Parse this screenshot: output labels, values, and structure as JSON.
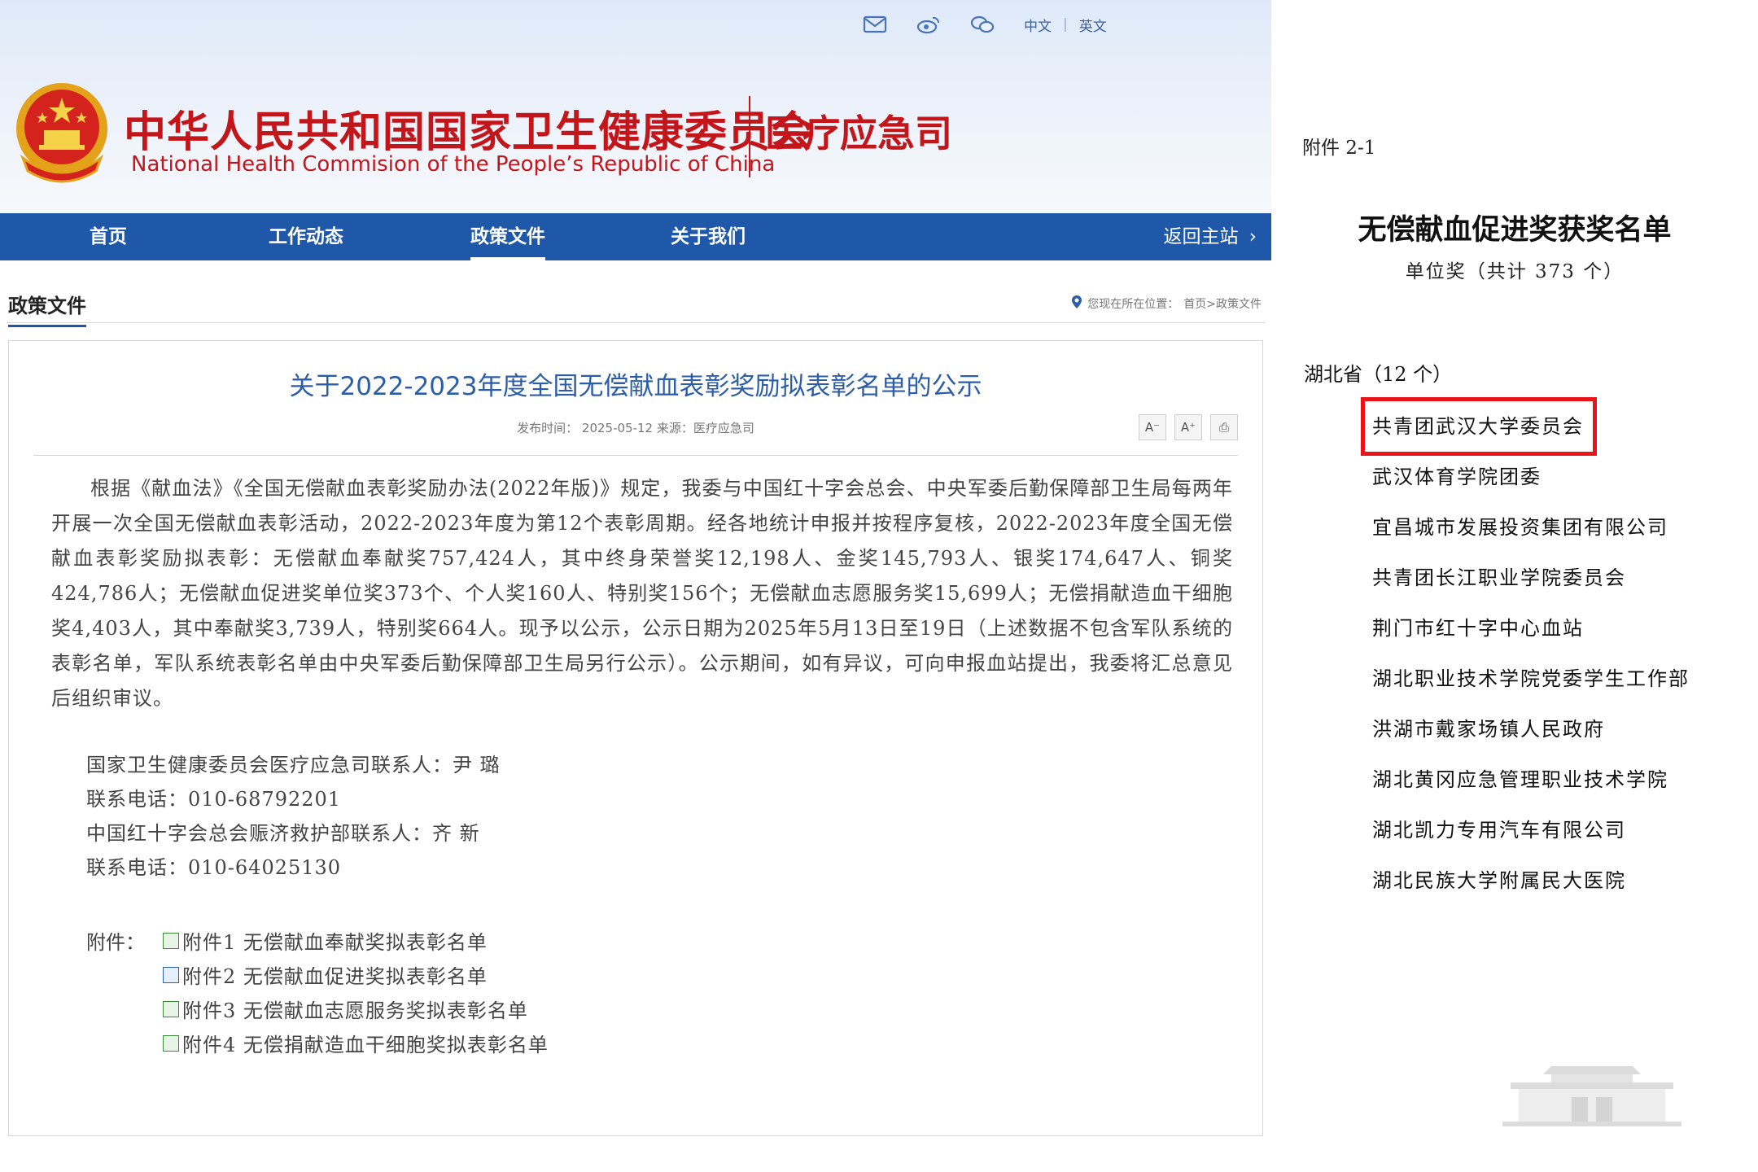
{
  "header": {
    "top_links": {
      "lang_cn": "中文",
      "lang_sep": "|",
      "lang_en": "英文"
    },
    "title": "中华人民共和国国家卫生健康委员会",
    "subtitle": "National Health Commision of the People’s  Republic of China",
    "department": "医疗应急司"
  },
  "nav": {
    "items": [
      "首页",
      "工作动态",
      "政策文件",
      "关于我们"
    ],
    "active": "政策文件",
    "back_label": "返回主站"
  },
  "breadcrumb": {
    "section": "政策文件",
    "location_label": "您现在所在位置：",
    "path": "首页>政策文件"
  },
  "article": {
    "title": "关于2022-2023年度全国无偿献血表彰奖励拟表彰名单的公示",
    "meta": "发布时间：  2025-05-12     来源：医疗应急司",
    "tools": {
      "font_smaller": "A⁻",
      "font_larger": "A⁺",
      "print": "⎙"
    },
    "body": "根据《献血法》《全国无偿献血表彰奖励办法(2022年版)》规定，我委与中国红十字会总会、中央军委后勤保障部卫生局每两年开展一次全国无偿献血表彰活动，2022-2023年度为第12个表彰周期。经各地统计申报并按程序复核，2022-2023年度全国无偿献血表彰奖励拟表彰：无偿献血奉献奖757,424人，其中终身荣誉奖12,198人、金奖145,793人、银奖174,647人、铜奖424,786人；无偿献血促进奖单位奖373个、个人奖160人、特别奖156个；无偿献血志愿服务奖15,699人；无偿捐献造血干细胞奖4,403人，其中奉献奖3,739人，特别奖664人。现予以公示，公示日期为2025年5月13日至19日（上述数据不包含军队系统的表彰名单，军队系统表彰名单由中央军委后勤保障部卫生局另行公示）。公示期间，如有异议，可向申报血站提出，我委将汇总意见后组织审议。",
    "contacts": [
      "国家卫生健康委员会医疗应急司联系人：尹  璐",
      "联系电话：010-68792201",
      "中国红十字会总会赈济救护部联系人：齐  新",
      "联系电话：010-64025130"
    ],
    "attachments_label": "附件：",
    "attachments": [
      "附件1  无偿献血奉献奖拟表彰名单",
      "附件2  无偿献血促进奖拟表彰名单",
      "附件3  无偿献血志愿服务奖拟表彰名单",
      "附件4  无偿捐献造血干细胞奖拟表彰名单"
    ]
  },
  "document": {
    "attachment_no": "附件 2-1",
    "title": "无偿献血促进奖获奖名单",
    "subtitle": "单位奖（共计 373 个）",
    "province": "湖北省（12 个）",
    "items": [
      "共青团武汉大学委员会",
      "武汉体育学院团委",
      "宜昌城市发展投资集团有限公司",
      "共青团长江职业学院委员会",
      "荆门市红十字中心血站",
      "湖北职业技术学院党委学生工作部",
      "洪湖市戴家场镇人民政府",
      "湖北黄冈应急管理职业技术学院",
      "湖北凯力专用汽车有限公司",
      "湖北民族大学附属民大医院"
    ],
    "highlight_color": "#e8141a"
  },
  "colors": {
    "brand_red": "#c2161b",
    "nav_blue": "#1f58a8",
    "title_blue": "#2c5ea8"
  },
  "icons": [
    "mail-icon",
    "weibo-icon",
    "wechat-icon",
    "location-pin-icon",
    "excel-file-icon",
    "word-file-icon"
  ]
}
